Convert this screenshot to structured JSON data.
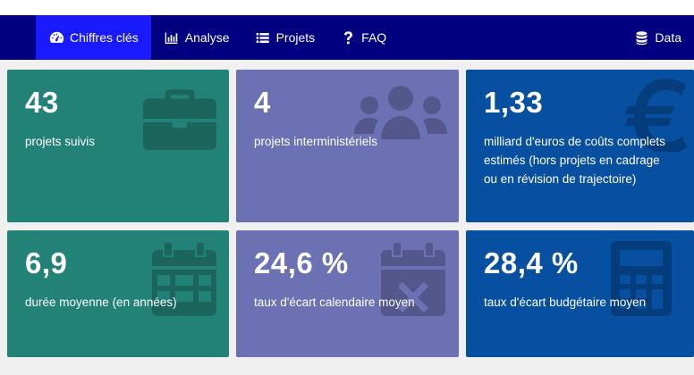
{
  "nav": {
    "items": [
      {
        "label": "Chiffres clés",
        "icon": "dashboard-icon",
        "active": true
      },
      {
        "label": "Analyse",
        "icon": "bar-chart-icon",
        "active": false
      },
      {
        "label": "Projets",
        "icon": "list-icon",
        "active": false
      },
      {
        "label": "FAQ",
        "icon": "question-icon",
        "active": false
      }
    ],
    "data_label": "Data",
    "data_icon": "database-icon"
  },
  "cards": [
    {
      "value": "43",
      "label": "projets suivis",
      "icon": "briefcase-icon",
      "color": "#238277"
    },
    {
      "value": "4",
      "label": "projets interministériels",
      "icon": "users-icon",
      "color": "#6b71b3"
    },
    {
      "value": "1,33",
      "label": "milliard d'euros de coûts complets estimés (hors projets en cadrage ou en révision de trajectoire)",
      "icon": "euro-icon",
      "color": "#074fa0"
    },
    {
      "value": "6,9",
      "label": "durée moyenne (en années)",
      "icon": "calendar-icon",
      "color": "#238277"
    },
    {
      "value": "24,6 %",
      "label": "taux d'écart calendaire moyen",
      "icon": "calendar-times-icon",
      "color": "#6b71b3"
    },
    {
      "value": "28,4 %",
      "label": "taux d'écart budgétaire moyen",
      "icon": "calculator-icon",
      "color": "#074fa0"
    }
  ]
}
